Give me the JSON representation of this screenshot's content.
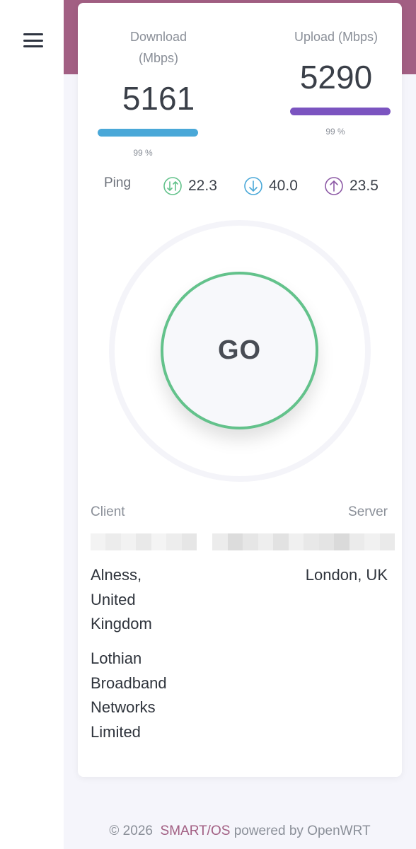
{
  "menu": {
    "icon": "hamburger-menu-icon"
  },
  "colors": {
    "header": "#a25f83",
    "download_bar": "#4aa8d8",
    "upload_bar": "#7b54c0",
    "go_ring": "#63c28b",
    "brand": "#a25f83"
  },
  "download": {
    "label_line1": "Download",
    "label_line2": "(Mbps)",
    "value": "5161",
    "percent": "99 %",
    "progress": 0.99
  },
  "upload": {
    "label": "Upload (Mbps)",
    "value": "5290",
    "percent": "99 %",
    "progress": 0.99
  },
  "ping": {
    "label": "Ping",
    "items": [
      {
        "icon": "jitter-arrows-icon",
        "value": "22.3"
      },
      {
        "icon": "download-arrow-icon",
        "value": "40.0"
      },
      {
        "icon": "upload-arrow-icon",
        "value": "23.5"
      }
    ]
  },
  "go_button": {
    "label": "GO"
  },
  "client": {
    "heading": "Client",
    "location_lines": [
      "Alness,",
      "United",
      "Kingdom"
    ],
    "isp_lines": [
      "Lothian",
      "Broadband",
      "Networks",
      "Limited"
    ]
  },
  "server": {
    "heading": "Server",
    "location": "London, UK"
  },
  "footer": {
    "copyright": "© 2026",
    "brand": "SMART/OS",
    "powered": "powered by OpenWRT"
  }
}
